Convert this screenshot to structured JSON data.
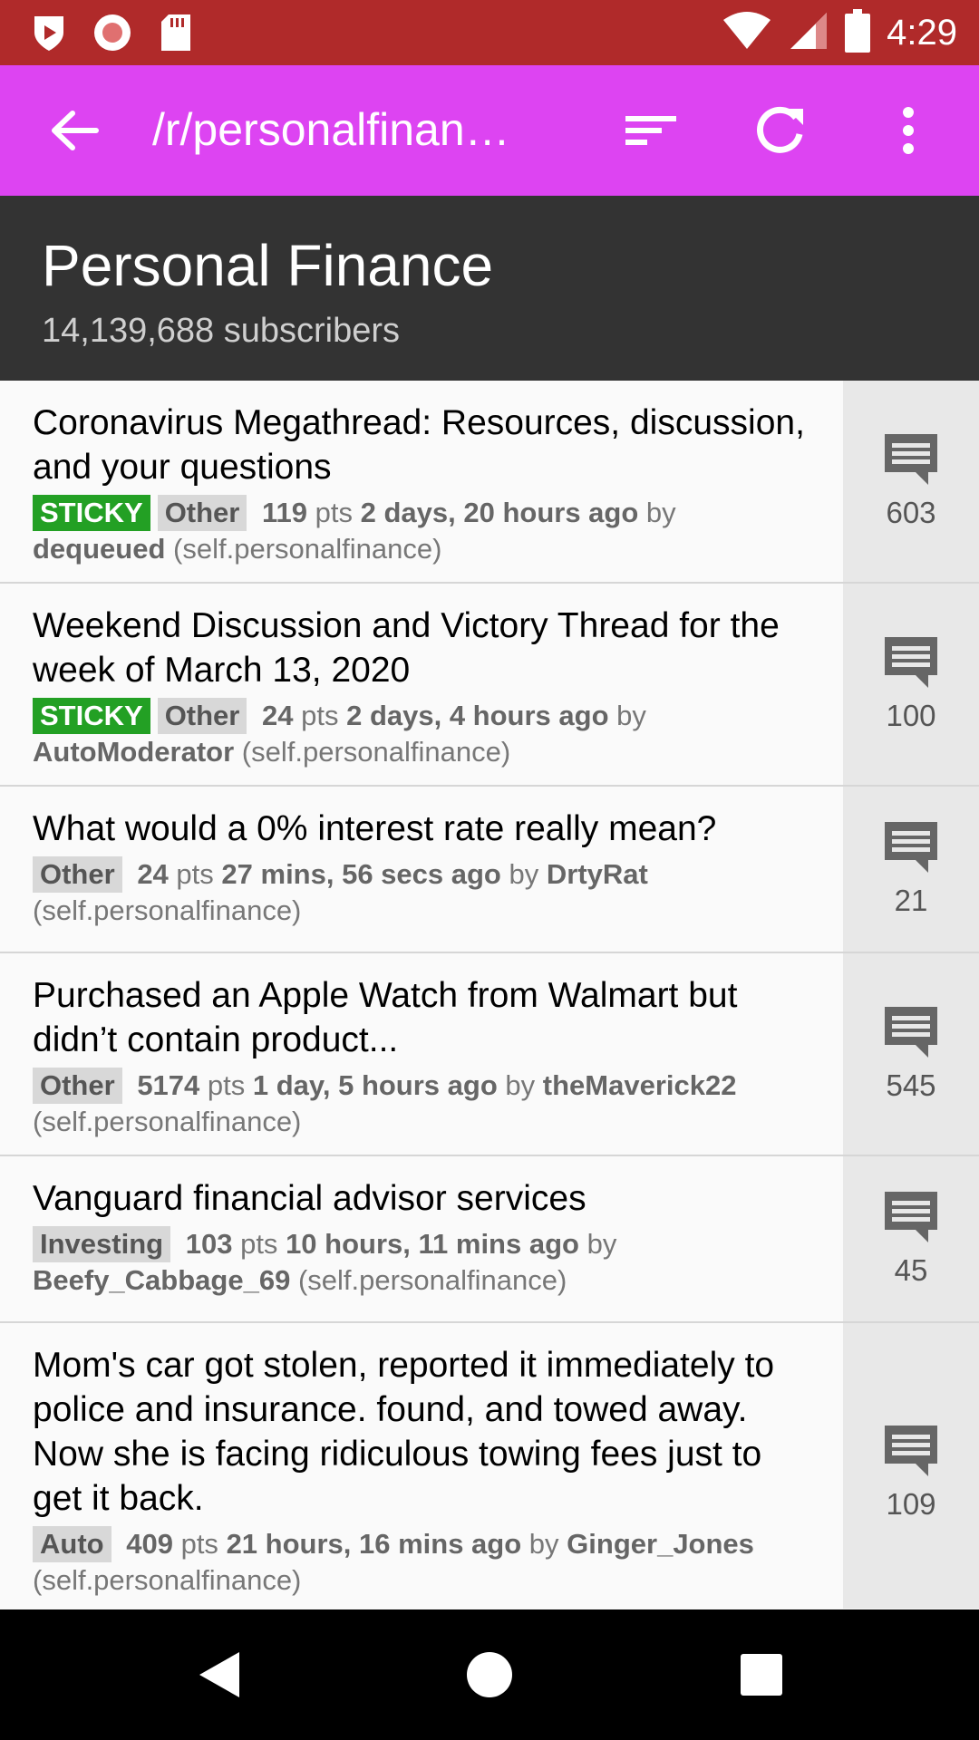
{
  "status_bar": {
    "time": "4:29",
    "icons": [
      "play-shield-icon",
      "record-icon",
      "sdcard-icon",
      "wifi-icon",
      "signal-icon",
      "battery-icon"
    ]
  },
  "app_bar": {
    "title": "/r/personalfinan…",
    "color": "#dd44f2",
    "actions": [
      "back-arrow-icon",
      "sort-icon",
      "refresh-icon",
      "overflow-menu-icon"
    ]
  },
  "subreddit": {
    "name": "Personal Finance",
    "subscribers": "14,139,688 subscribers"
  },
  "posts": [
    {
      "title": "Coronavirus Megathread: Resources, discussion, and your questions",
      "sticky": "STICKY",
      "flair": "Other",
      "points": "119",
      "pts_label": "pts",
      "age": "2 days, 20 hours ago",
      "by_label": "by",
      "author": "dequeued",
      "domain": "(self.personalfinance)",
      "comments": "603"
    },
    {
      "title": "Weekend Discussion and Victory Thread for the week of March 13, 2020",
      "sticky": "STICKY",
      "flair": "Other",
      "points": "24",
      "pts_label": "pts",
      "age": "2 days, 4 hours ago",
      "by_label": "by",
      "author": "AutoModerator",
      "domain": "(self.personalfinance)",
      "comments": "100"
    },
    {
      "title": "What would a 0% interest rate really mean?",
      "flair": "Other",
      "points": "24",
      "pts_label": "pts",
      "age": "27 mins, 56 secs ago",
      "by_label": "by",
      "author": "DrtyRat",
      "domain": "(self.personalfinance)",
      "comments": "21"
    },
    {
      "title": "Purchased an Apple Watch from Walmart but didn’t contain product...",
      "flair": "Other",
      "points": "5174",
      "pts_label": "pts",
      "age": "1 day, 5 hours ago",
      "by_label": "by",
      "author": "theMaverick22",
      "domain": "(self.personalfinance)",
      "comments": "545"
    },
    {
      "title": "Vanguard financial advisor services",
      "flair": "Investing",
      "points": "103",
      "pts_label": "pts",
      "age": "10 hours, 11 mins ago",
      "by_label": "by",
      "author": "Beefy_Cabbage_69",
      "domain": "(self.personalfinance)",
      "comments": "45"
    },
    {
      "title": "Mom's car got stolen, reported it immediately to police and insurance. found, and towed away. Now she is facing ridiculous towing fees just to get it back.",
      "flair": "Auto",
      "points": "409",
      "pts_label": "pts",
      "age": "21 hours, 16 mins ago",
      "by_label": "by",
      "author": "Ginger_Jones",
      "domain": "(self.personalfinance)",
      "comments": "109"
    }
  ],
  "nav_bar": {
    "buttons": [
      "back-triangle-icon",
      "home-circle-icon",
      "recents-square-icon"
    ]
  }
}
